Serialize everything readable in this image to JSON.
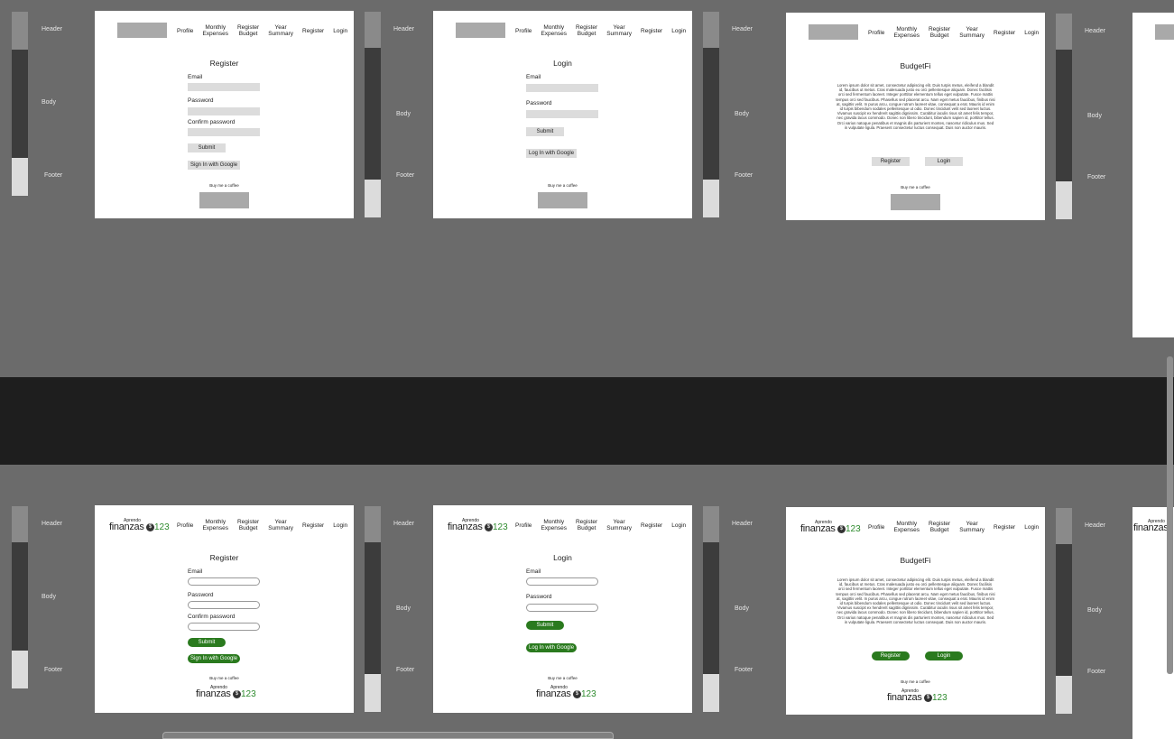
{
  "annotations": {
    "header": "Header",
    "body": "Body",
    "footer": "Footer"
  },
  "nav": {
    "profile": "Profile",
    "monthly": "Monthly Expenses",
    "monthly_l1": "Monthly",
    "monthly_l2": "Expenses",
    "budget_l1": "Register",
    "budget_l2": "Budget",
    "year_l1": "Year",
    "year_l2": "Summary",
    "register": "Register",
    "login": "Login"
  },
  "brand": {
    "small": "Aprendo",
    "word": "finanzas",
    "coin": "$",
    "number": "123"
  },
  "register_page": {
    "title": "Register",
    "email_label": "Email",
    "password_label": "Password",
    "confirm_label": "Confirm password",
    "submit": "Submit",
    "google": "Sign In with Google"
  },
  "login_page": {
    "title": "Login",
    "email_label": "Email",
    "password_label": "Password",
    "submit": "Submit",
    "google": "Log In with Google"
  },
  "home_page": {
    "title": "BudgetFi",
    "lorem": "Lorem ipsum dolor sit amet, consectetur adipiscing elit. Duis turpis metus, eleifend a blandit id, faucibus ut metus. Cras malesuada justo eu orci pellentesque aliquam. Donec facilisis orci sed fermentum laoreet. Integer porttitor elementum tellus eget vulputate. Fusce mattis tempus orci sed faucibus. Phasellus sed placerat arcu. Nam eget metus faucibus, finibus nisi at, sagittis velit. In purus arcu, congue rutrum laoreet vitae, consequat a erat. Mauris id enim id turpis bibendum sodales pellentesque ut odio. Donec tincidunt velit sed laoreet luctus. Vivamus suscipit ex hendrerit sagittis dignissim. Curabitur iaculis risus sit amet felis tempor, nec gravida lacus commodo. Donec non libero tincidunt, bibendum sapien id, porttitor tellus. Orci varius natoque penatibus et magnis dis parturient montes, nascetur ridiculus mus. Sed in vulputate ligula. Praesent consectetur luctus consequat. Duis non auctor mauris.",
    "register": "Register",
    "login": "Login"
  },
  "footer": {
    "coffee": "Buy me a coffee"
  },
  "colors": {
    "accent_green": "#2a7a1e",
    "brand_green": "#2e8b2e",
    "wire_gray": "#dcdcdc"
  }
}
